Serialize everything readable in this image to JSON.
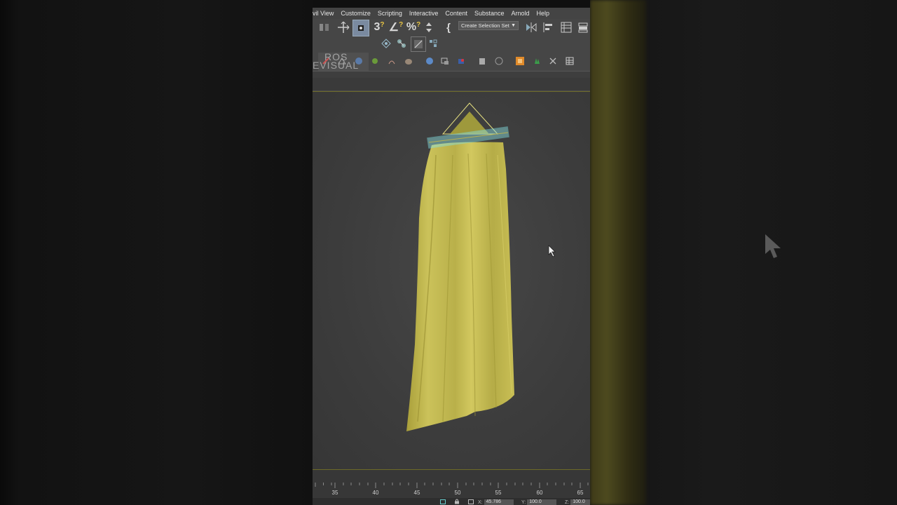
{
  "menu": [
    "vil View",
    "Customize",
    "Scripting",
    "Interactive",
    "Content",
    "Substance",
    "Arnold",
    "Help"
  ],
  "toolbar": {
    "selection_set": "Create Selection Set",
    "snap_3d": "3",
    "angle_snap": "∠",
    "percent_snap": "%",
    "braces": "{",
    "logo_line1": "ROS",
    "logo_line2": "EVISUAL"
  },
  "timeline": {
    "ticks": [
      "35",
      "40",
      "45",
      "50",
      "55",
      "60",
      "65"
    ]
  },
  "status": {
    "x_label": "X:",
    "x_value": "45.786",
    "y_label": "Y:",
    "y_value": "100.0",
    "z_label": "Z:",
    "z_value": "100.0"
  },
  "colors": {
    "curtain": "#c9bf55",
    "selection": "#7fe3e6",
    "background": "#3e3e3e"
  }
}
